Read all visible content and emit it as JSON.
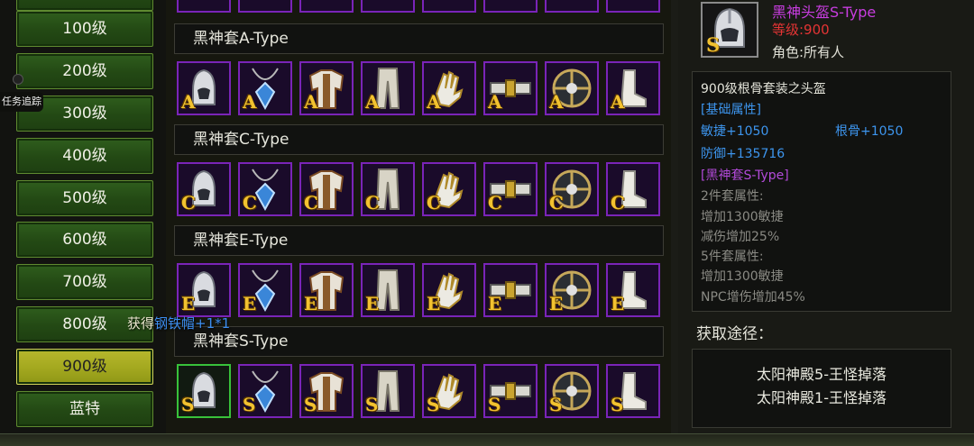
{
  "level_tabs": [
    {
      "label": "100级",
      "active": false
    },
    {
      "label": "200级",
      "active": false
    },
    {
      "label": "300级",
      "active": false
    },
    {
      "label": "400级",
      "active": false
    },
    {
      "label": "500级",
      "active": false
    },
    {
      "label": "600级",
      "active": false
    },
    {
      "label": "700级",
      "active": false
    },
    {
      "label": "800级",
      "active": false
    },
    {
      "label": "900级",
      "active": true
    },
    {
      "label": "蓝特",
      "active": false
    }
  ],
  "quest_tracker_label": "任务追踪",
  "sets": [
    {
      "name": "黑神套A-Type",
      "grade": "A"
    },
    {
      "name": "黑神套C-Type",
      "grade": "C"
    },
    {
      "name": "黑神套E-Type",
      "grade": "E"
    },
    {
      "name": "黑神套S-Type",
      "grade": "S"
    }
  ],
  "slot_icons": [
    "helmet-icon",
    "necklace-icon",
    "armor-icon",
    "pants-icon",
    "gloves-icon",
    "belt-icon",
    "shield-icon",
    "boots-icon"
  ],
  "gain_message": {
    "prefix": "获得",
    "item": "钢铁帽+1*1"
  },
  "detail": {
    "grade": "S",
    "name": "黑神头盔S-Type",
    "level": "等级:900",
    "role": "角色:所有人",
    "title": "900级根骨套装之头盔",
    "base_header": "[基础属性]",
    "agility": "敏捷+1050",
    "root": "根骨+1050",
    "defense": "防御+135716",
    "set_header": "[黑神套S-Type]",
    "set2_title": "2件套属性:",
    "set2_a": "增加1300敏捷",
    "set2_b": "减伤增加25%",
    "set5_title": "5件套属性:",
    "set5_a": "增加1300敏捷",
    "set5_b": "NPC增伤增加45%",
    "source_title": "获取途径：",
    "sources": [
      "太阳神殿5-王怪掉落",
      "太阳神殿1-王怪掉落"
    ]
  },
  "colors": {
    "slot_border": "#7a24b8",
    "grade_letter": "#f2c230",
    "active_tab": "#a3a81f",
    "tab": "#234914",
    "name": "#c83de0",
    "level": "#e43434",
    "attr_blue": "#3d95ee"
  }
}
